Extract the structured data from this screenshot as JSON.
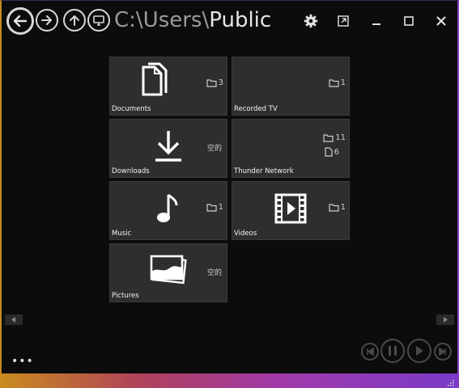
{
  "window": {
    "path_prefix": "C:\\Users\\",
    "path_current": "Public"
  },
  "tiles": [
    {
      "label": "Documents",
      "icon": "documents-icon",
      "counts": [
        {
          "icon": "folder-icon",
          "value": "3"
        }
      ]
    },
    {
      "label": "Recorded TV",
      "icon": "none",
      "counts": [
        {
          "icon": "folder-icon",
          "value": "1"
        }
      ]
    },
    {
      "label": "Downloads",
      "icon": "download-icon",
      "empty": "空的"
    },
    {
      "label": "Thunder Network",
      "icon": "none",
      "counts": [
        {
          "icon": "folder-icon",
          "value": "11"
        },
        {
          "icon": "file-icon",
          "value": "6"
        }
      ]
    },
    {
      "label": "Music",
      "icon": "music-note-icon",
      "counts": [
        {
          "icon": "folder-icon",
          "value": "1"
        }
      ]
    },
    {
      "label": "Videos",
      "icon": "film-icon",
      "counts": [
        {
          "icon": "folder-icon",
          "value": "1"
        }
      ]
    },
    {
      "label": "Pictures",
      "icon": "pictures-icon",
      "empty": "空的"
    }
  ],
  "footer": {
    "more": "•••"
  },
  "colors": {
    "accent_left": "#c98a1e",
    "accent_right": "#8a3bbf",
    "tile_bg": "#2e2e2e"
  }
}
